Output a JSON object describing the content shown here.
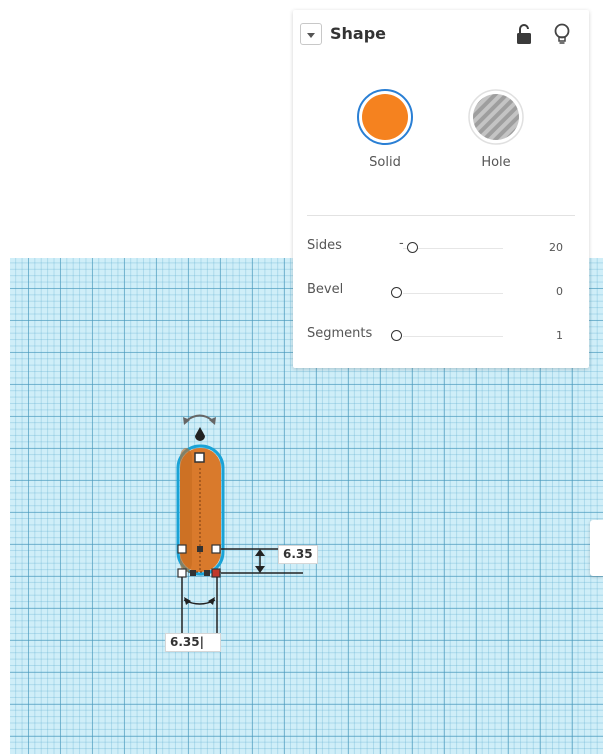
{
  "shape_panel": {
    "title": "Shape",
    "collapse_icon": "caret-down-icon",
    "lock_icon": "unlock-icon",
    "bulb_icon": "lightbulb-icon",
    "types": {
      "solid": {
        "label": "Solid",
        "color": "#f5821f",
        "selected": true
      },
      "hole": {
        "label": "Hole"
      }
    },
    "properties": [
      {
        "label": "Sides",
        "value": "20",
        "level": 0.1
      },
      {
        "label": "Bevel",
        "value": "0",
        "level": 0
      },
      {
        "label": "Segments",
        "value": "1",
        "level": 0
      }
    ]
  },
  "workplane": {
    "grid_color": "#cfeef8",
    "shape_color": "#d97a2c",
    "selection_outline_color": "#1aa3d6",
    "dimensions": {
      "height_value": "6.35",
      "width_value": "6.35|"
    }
  }
}
